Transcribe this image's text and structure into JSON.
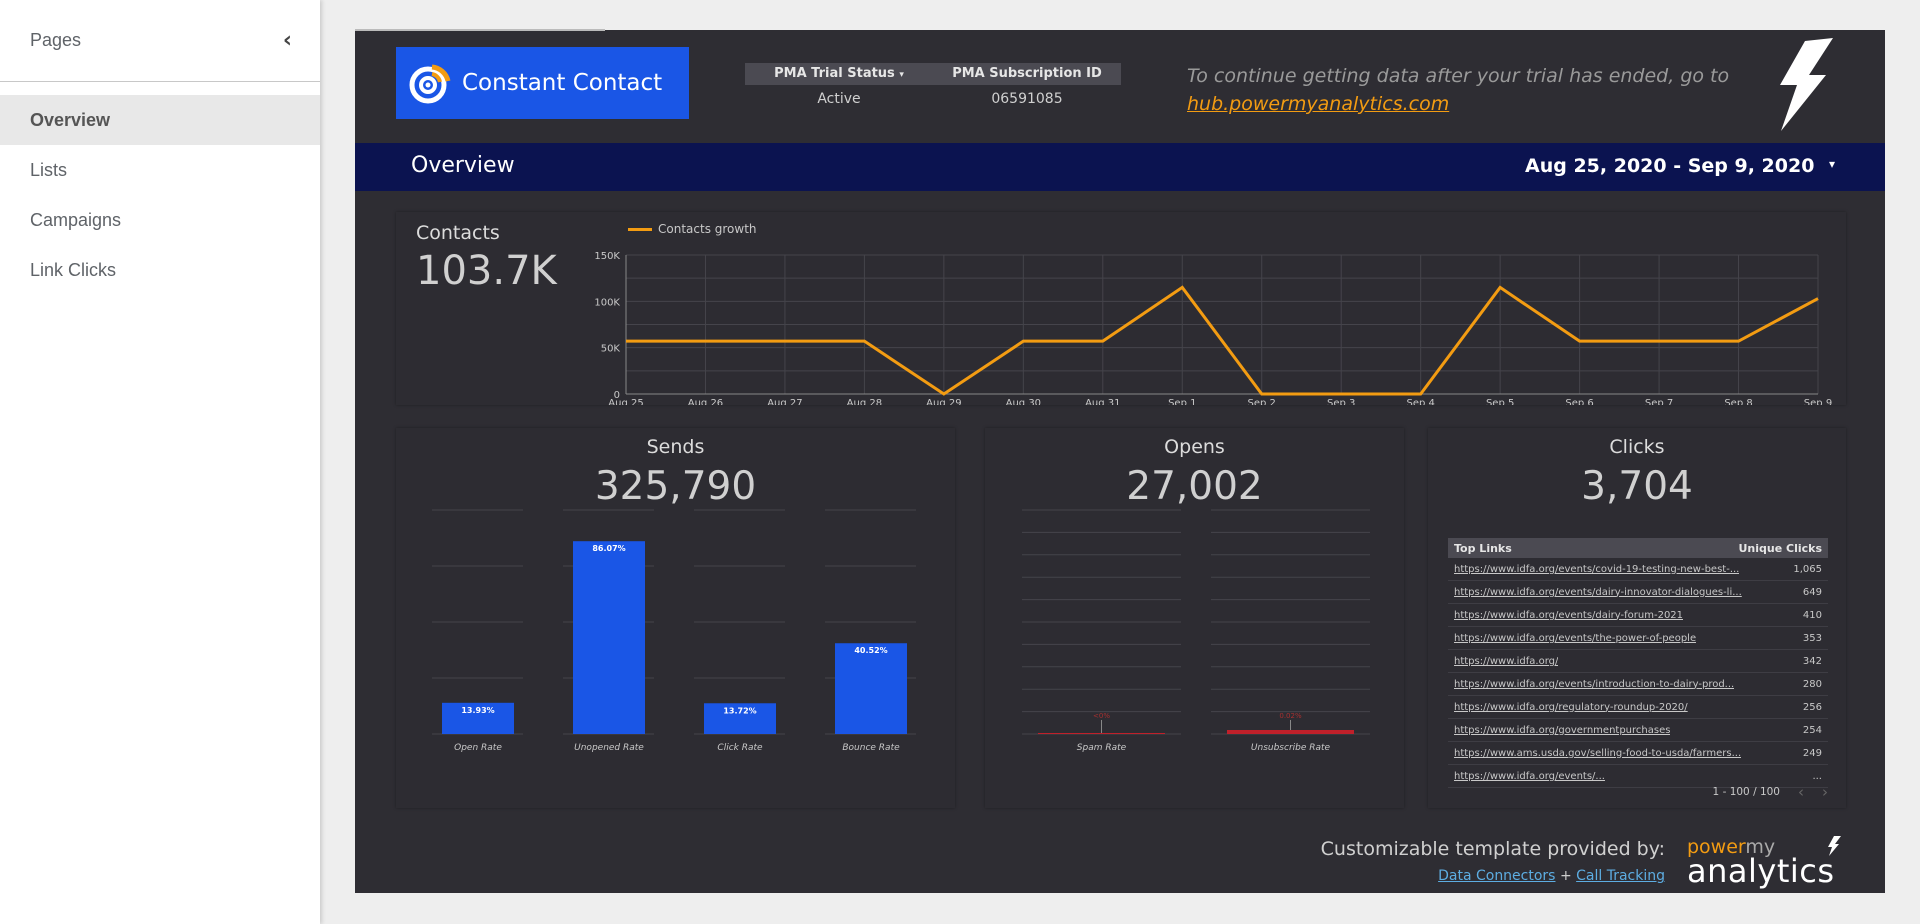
{
  "sidebar": {
    "title": "Pages",
    "items": [
      {
        "label": "Overview",
        "active": true
      },
      {
        "label": "Lists",
        "active": false
      },
      {
        "label": "Campaigns",
        "active": false
      },
      {
        "label": "Link Clicks",
        "active": false
      }
    ]
  },
  "header": {
    "logo_text": "Constant Contact",
    "status_table": {
      "col1_header": "PMA Trial Status",
      "col1_caret": "▾",
      "col2_header": "PMA Subscription ID",
      "col1_value": "Active",
      "col2_value": "06591085"
    },
    "trial_note": "To continue getting data after your trial has ended, go to",
    "trial_link": "hub.powermyanalytics.com"
  },
  "band": {
    "title": "Overview",
    "date_range": "Aug 25, 2020 - Sep 9, 2020",
    "caret": "▾"
  },
  "contacts": {
    "label": "Contacts",
    "value": "103.7K"
  },
  "colors": {
    "line": "#f39c12",
    "bar": "#1a56e6",
    "red_bar": "#c0202a",
    "band": "#0b1350"
  },
  "sends": {
    "label": "Sends",
    "value": "325,790"
  },
  "opens": {
    "label": "Opens",
    "value": "27,002"
  },
  "clicks": {
    "label": "Clicks",
    "value": "3,704",
    "table": {
      "col1": "Top Links",
      "col2": "Unique Clicks",
      "rows": [
        {
          "url": "https://www.idfa.org/events/covid-19-testing-new-best-...",
          "clicks": "1,065"
        },
        {
          "url": "https://www.idfa.org/events/dairy-innovator-dialogues-li...",
          "clicks": "649"
        },
        {
          "url": "https://www.idfa.org/events/dairy-forum-2021",
          "clicks": "410"
        },
        {
          "url": "https://www.idfa.org/events/the-power-of-people",
          "clicks": "353"
        },
        {
          "url": "https://www.idfa.org/",
          "clicks": "342"
        },
        {
          "url": "https://www.idfa.org/events/introduction-to-dairy-prod...",
          "clicks": "280"
        },
        {
          "url": "https://www.idfa.org/regulatory-roundup-2020/",
          "clicks": "256"
        },
        {
          "url": "https://www.idfa.org/governmentpurchases",
          "clicks": "254"
        },
        {
          "url": "https://www.ams.usda.gov/selling-food-to-usda/farmers...",
          "clicks": "249"
        },
        {
          "url": "https://www.idfa.org/events/...",
          "clicks": "..."
        }
      ],
      "pager": "1 - 100 / 100",
      "prev": "‹",
      "next": "›"
    }
  },
  "footer": {
    "text": "Customizable template provided by:",
    "link1": "Data Connectors",
    "plus": "+",
    "link2": "Call Tracking",
    "logo_power": "power",
    "logo_my": "my",
    "logo_analytics": "analytics"
  },
  "chart_data": [
    {
      "type": "line",
      "title": "",
      "legend": [
        "Contacts growth"
      ],
      "legend_position": "top-left",
      "x": [
        "Aug 25",
        "Aug 26",
        "Aug 27",
        "Aug 28",
        "Aug 29",
        "Aug 30",
        "Aug 31",
        "Sep 1",
        "Sep 2",
        "Sep 3",
        "Sep 4",
        "Sep 5",
        "Sep 6",
        "Sep 7",
        "Sep 8",
        "Sep 9"
      ],
      "series": [
        {
          "name": "Contacts growth",
          "values": [
            57000,
            57000,
            57000,
            57000,
            0,
            57000,
            57000,
            115000,
            0,
            0,
            0,
            115000,
            57000,
            57000,
            57000,
            103000
          ]
        }
      ],
      "yticks": [
        "0",
        "50K",
        "100K",
        "150K"
      ],
      "ylim": [
        0,
        150000
      ],
      "grid": true
    },
    {
      "type": "bar",
      "title": "Sends",
      "categories": [
        "Open Rate",
        "Unopened Rate",
        "Click Rate",
        "Bounce Rate"
      ],
      "values": [
        13.93,
        86.07,
        13.72,
        40.52
      ],
      "labels": [
        "13.93%",
        "86.07%",
        "13.72%",
        "40.52%"
      ],
      "ylim": [
        0,
        100
      ],
      "grid": true
    },
    {
      "type": "bar",
      "title": "Opens",
      "categories": [
        "Spam Rate",
        "Unsubscribe Rate"
      ],
      "values": [
        0,
        0.02
      ],
      "labels": [
        "<0%",
        "0.02%"
      ],
      "grid": true
    }
  ]
}
